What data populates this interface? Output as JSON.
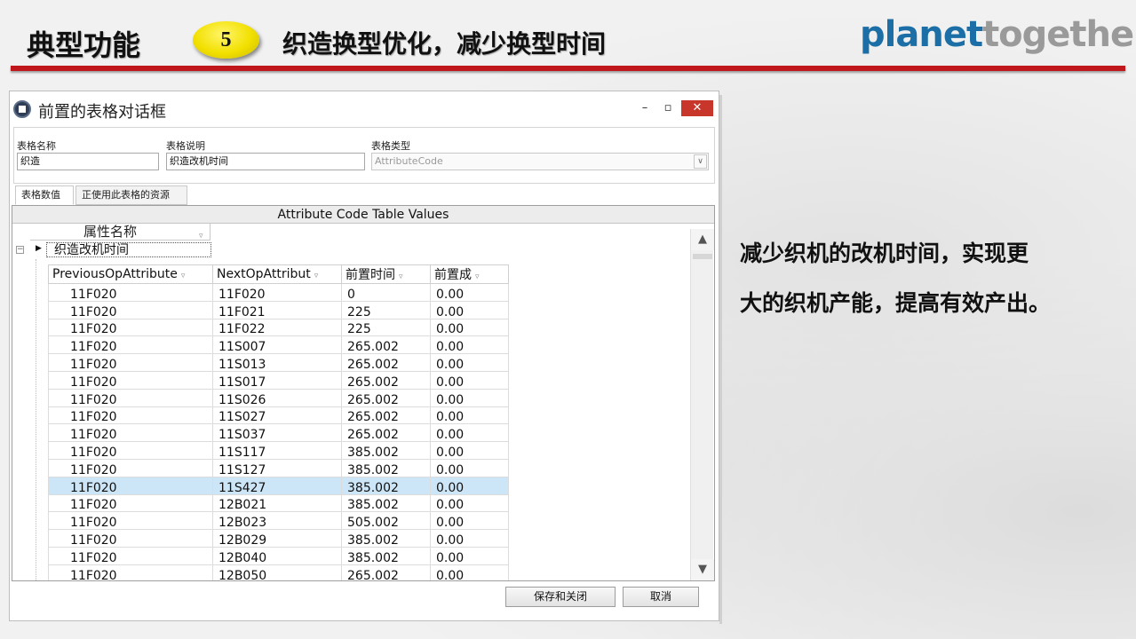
{
  "slide": {
    "title": "典型功能",
    "number": "5",
    "subtitle": "织造换型优化，减少换型时间",
    "logo_part1": "planet",
    "logo_part2": "together",
    "callout_line1": "减少织机的改机时间，实现更",
    "callout_line2": "大的织机产能，提高有效产出。"
  },
  "dialog": {
    "window_title": "前置的表格对话框",
    "minimize": "–",
    "maximize": "▫",
    "close": "✕",
    "fields": {
      "name_label": "表格名称",
      "name_value": "织造",
      "desc_label": "表格说明",
      "desc_value": "织造改机时间",
      "type_label": "表格类型",
      "type_value": "AttributeCode"
    },
    "tabs": [
      "表格数值",
      "正使用此表格的资源"
    ],
    "grid": {
      "caption": "Attribute Code Table Values",
      "band_header": "属性名称",
      "group_value": "织造改机时间",
      "columns": [
        "PreviousOpAttribute",
        "NextOpAttribut",
        "前置时间",
        "前置成"
      ],
      "rows": [
        [
          "11F020",
          "11F020",
          "0",
          "0.00"
        ],
        [
          "11F020",
          "11F021",
          "225",
          "0.00"
        ],
        [
          "11F020",
          "11F022",
          "225",
          "0.00"
        ],
        [
          "11F020",
          "11S007",
          "265.002",
          "0.00"
        ],
        [
          "11F020",
          "11S013",
          "265.002",
          "0.00"
        ],
        [
          "11F020",
          "11S017",
          "265.002",
          "0.00"
        ],
        [
          "11F020",
          "11S026",
          "265.002",
          "0.00"
        ],
        [
          "11F020",
          "11S027",
          "265.002",
          "0.00"
        ],
        [
          "11F020",
          "11S037",
          "265.002",
          "0.00"
        ],
        [
          "11F020",
          "11S117",
          "385.002",
          "0.00"
        ],
        [
          "11F020",
          "11S127",
          "385.002",
          "0.00"
        ],
        [
          "11F020",
          "11S427",
          "385.002",
          "0.00"
        ],
        [
          "11F020",
          "12B021",
          "385.002",
          "0.00"
        ],
        [
          "11F020",
          "12B023",
          "505.002",
          "0.00"
        ],
        [
          "11F020",
          "12B029",
          "385.002",
          "0.00"
        ],
        [
          "11F020",
          "12B040",
          "385.002",
          "0.00"
        ],
        [
          "11F020",
          "12B050",
          "265.002",
          "0.00"
        ]
      ],
      "selected_row": 11
    },
    "buttons": {
      "save": "保存和关闭",
      "cancel": "取消"
    }
  }
}
